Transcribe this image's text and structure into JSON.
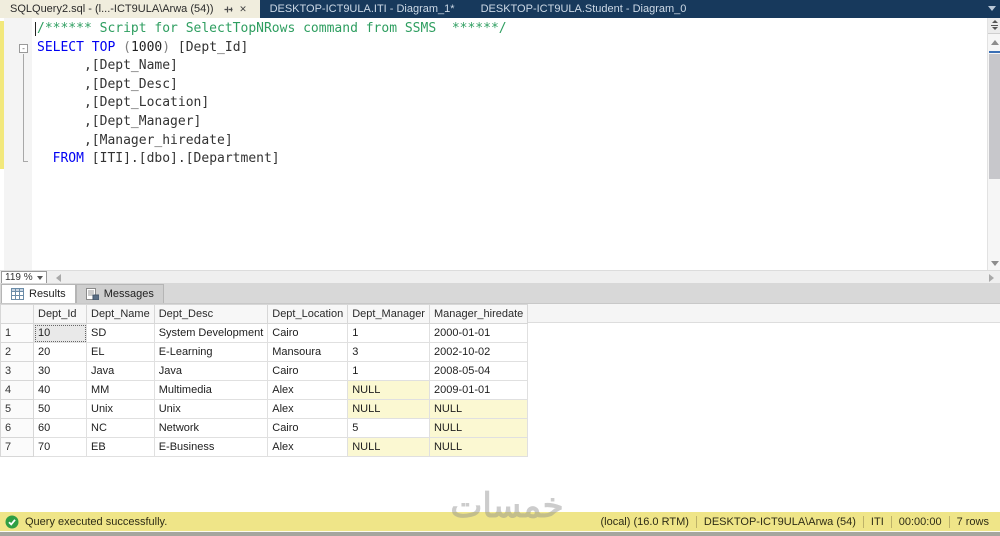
{
  "window": {
    "app": "SQL Server Management Studio"
  },
  "tabs": [
    {
      "label": "SQLQuery2.sql - (l...-ICT9ULA\\Arwa (54))",
      "active": true,
      "pinned": true
    },
    {
      "label": "DESKTOP-ICT9ULA.ITI - Diagram_1*",
      "active": false,
      "pinned": false
    },
    {
      "label": "DESKTOP-ICT9ULA.Student - Diagram_0",
      "active": false,
      "pinned": false
    }
  ],
  "editor": {
    "zoom_level": "119 %",
    "fold_glyph": "-",
    "code_lines": [
      [
        {
          "c": "comment",
          "t": "/****** Script for SelectTopNRows command from SSMS  ******/"
        }
      ],
      [
        {
          "c": "keyword",
          "t": "SELECT"
        },
        {
          "c": "plain",
          "t": " "
        },
        {
          "c": "keyword",
          "t": "TOP"
        },
        {
          "c": "plain",
          "t": " "
        },
        {
          "c": "gray",
          "t": "("
        },
        {
          "c": "number",
          "t": "1000"
        },
        {
          "c": "gray",
          "t": ")"
        },
        {
          "c": "plain",
          "t": " [Dept_Id]"
        }
      ],
      [
        {
          "c": "plain",
          "t": "      ,[Dept_Name]"
        }
      ],
      [
        {
          "c": "plain",
          "t": "      ,[Dept_Desc]"
        }
      ],
      [
        {
          "c": "plain",
          "t": "      ,[Dept_Location]"
        }
      ],
      [
        {
          "c": "plain",
          "t": "      ,[Dept_Manager]"
        }
      ],
      [
        {
          "c": "plain",
          "t": "      ,[Manager_hiredate]"
        }
      ],
      [
        {
          "c": "plain",
          "t": "  "
        },
        {
          "c": "keyword",
          "t": "FROM"
        },
        {
          "c": "plain",
          "t": " [ITI].[dbo].[Department]"
        }
      ]
    ]
  },
  "results_tabs": {
    "results": "Results",
    "messages": "Messages"
  },
  "results": {
    "columns": [
      "Dept_Id",
      "Dept_Name",
      "Dept_Desc",
      "Dept_Location",
      "Dept_Manager",
      "Manager_hiredate"
    ],
    "rows": [
      [
        "10",
        "SD",
        "System Development",
        "Cairo",
        "1",
        "2000-01-01"
      ],
      [
        "20",
        "EL",
        "E-Learning",
        "Mansoura",
        "3",
        "2002-10-02"
      ],
      [
        "30",
        "Java",
        "Java",
        "Cairo",
        "1",
        "2008-05-04"
      ],
      [
        "40",
        "MM",
        "Multimedia",
        "Alex",
        "NULL",
        "2009-01-01"
      ],
      [
        "50",
        "Unix",
        "Unix",
        "Alex",
        "NULL",
        "NULL"
      ],
      [
        "60",
        "NC",
        "Network",
        "Cairo",
        "5",
        "NULL"
      ],
      [
        "70",
        "EB",
        "E-Business",
        "Alex",
        "NULL",
        "NULL"
      ]
    ],
    "selected_cell": {
      "row": 0,
      "col": 0
    }
  },
  "status_bar": {
    "message": "Query executed successfully.",
    "segments": [
      "(local) (16.0 RTM)",
      "DESKTOP-ICT9ULA\\Arwa (54)",
      "ITI",
      "00:00:00",
      "7 rows"
    ]
  },
  "watermark": "خمسات",
  "colors": {
    "tabbar_bg": "#17395c",
    "active_tab_bg": "#f0eddd",
    "keyword_blue": "#0000f2",
    "comment_green": "#2e9e60",
    "null_cell_bg": "#fbf8d2",
    "status_bg": "#efe588"
  }
}
